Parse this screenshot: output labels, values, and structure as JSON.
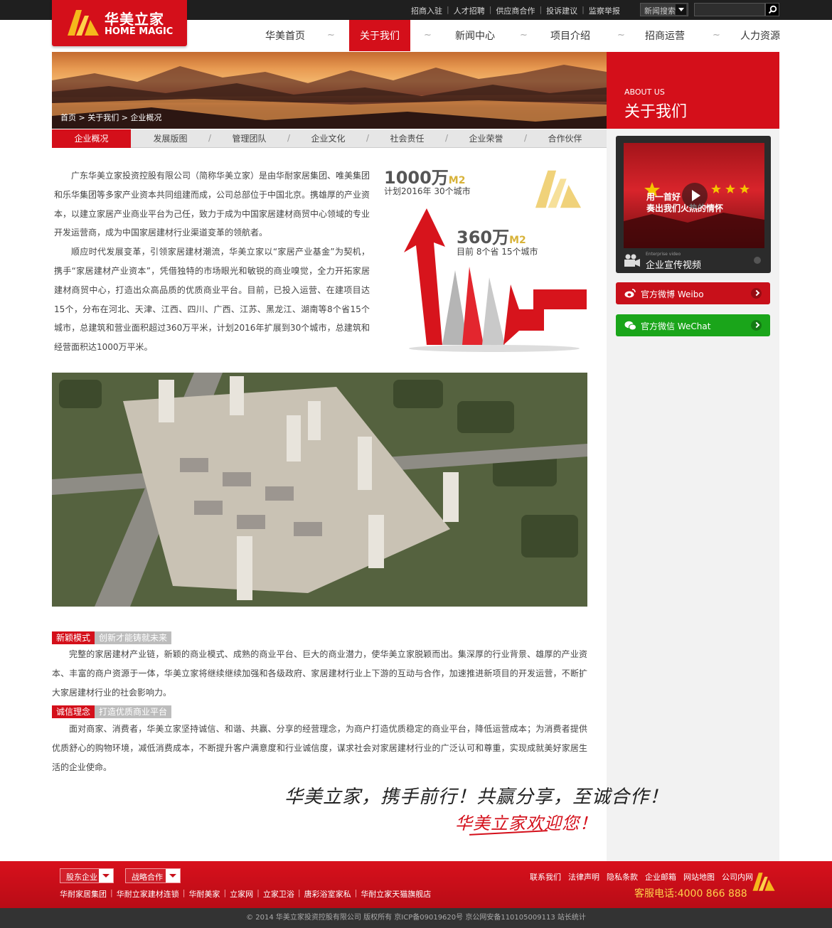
{
  "top_links": [
    "招商入驻",
    "人才招聘",
    "供应商合作",
    "投诉建议",
    "监察举报"
  ],
  "search": {
    "select_label": "新闻搜索",
    "placeholder": ""
  },
  "logo": {
    "cn": "华美立家",
    "en": "HOME MAGIC"
  },
  "nav": {
    "items": [
      "华美首页",
      "关于我们",
      "新闻中心",
      "项目介绍",
      "招商运营",
      "人力资源"
    ],
    "active_index": 1,
    "separator": "~"
  },
  "banner": {
    "breadcrumb": [
      "首页",
      "关于我们",
      "企业概况"
    ],
    "side_en": "ABOUT US",
    "side_cn": "关于我们"
  },
  "subnav": {
    "tabs": [
      "企业概况",
      "发展版图",
      "管理团队",
      "企业文化",
      "社会责任",
      "企业荣誉",
      "合作伙伴"
    ],
    "active_index": 0,
    "separator": "/"
  },
  "intro": {
    "p1": "广东华美立家投资控股有限公司（简称华美立家）是由华耐家居集团、唯美集团和乐华集团等多家产业资本共同组建而成，公司总部位于中国北京。携雄厚的产业资本，以建立家居产业商业平台为己任，致力于成为中国家居建材商贸中心领域的专业开发运营商，成为中国家居建材行业渠道变革的领航者。",
    "p2": "顺应时代发展变革，引领家居建材潮流，华美立家以“家居产业基金”为契机，携手“家居建材产业资本”，凭借独特的市场眼光和敏锐的商业嗅觉，全力开拓家居建材商贸中心，打造出众高品质的优质商业平台。目前，已投入运营、在建项目达15个，分布在河北、天津、江西、四川、广西、江苏、黑龙江、湖南等8个省15个城市，总建筑和营业面积超过360万平米，计划2016年扩展到30个城市，总建筑和经营面积达1000万平米。"
  },
  "stats": {
    "s1_num": "1000万",
    "s1_unit": "M2",
    "s1_sub": "计划2016年 30个城市",
    "s2_num": "360万",
    "s2_unit": "M2",
    "s2_sub": "目前 8个省 15个城市"
  },
  "section1": {
    "tag": "新颖模式",
    "subtitle": "创新才能铸就未来",
    "text": "完整的家居建材产业链，新颖的商业模式、成熟的商业平台、巨大的商业潜力，使华美立家脱颖而出。集深厚的行业背景、雄厚的产业资本、丰富的商户资源于一体，华美立家将继续继续加强和各级政府、家居建材行业上下游的互动与合作，加速推进新项目的开发运营，不断扩大家居建材行业的社会影响力。"
  },
  "section2": {
    "tag": "诚信理念",
    "subtitle": "打造优质商业平台",
    "text": "面对商家、消费者，华美立家坚持诚信、和谐、共赢、分享的经营理念，为商户打造优质稳定的商业平台，降低运营成本；为消费者提供优质舒心的购物环境，减低消费成本，不断提升客户满意度和行业诚信度，谋求社会对家居建材行业的广泛认可和尊重，实现成就美好家居生活的企业使命。"
  },
  "slogan": {
    "line1": "华美立家，携手前行！共赢分享，至诚合作！",
    "line2": "华美立家欢迎您！"
  },
  "sidebar": {
    "video_thumb_line1": "用一首好",
    "video_thumb_line2": "奏出我们火热的情怀",
    "video_small": "Enterprise video",
    "video_label": "企业宣传视频",
    "weibo_label": "官方微博 Weibo",
    "wechat_label": "官方微信 WeChat"
  },
  "footer": {
    "select1": "股东企业",
    "select2": "战略合作",
    "links": [
      "华耐家居集团",
      "华耐立家建材连锁",
      "华耐美家",
      "立家网",
      "立家卫浴",
      "唐彩浴室家私",
      "华耐立家天猫旗舰店"
    ],
    "right_links": [
      "联系我们",
      "法律声明",
      "隐私条款",
      "企业邮箱",
      "网站地图",
      "公司内网"
    ],
    "phone": "客服电话:4000 866 888",
    "copyright": "©   2014  华美立家投资控股有限公司  版权所有  京ICP备09019620号  京公网安备110105009113  站长统计"
  },
  "colors": {
    "brand_red": "#d40f1a",
    "gold": "#f5b81c",
    "wechat_green": "#1aa51a",
    "topbar": "#1f1f1f"
  }
}
